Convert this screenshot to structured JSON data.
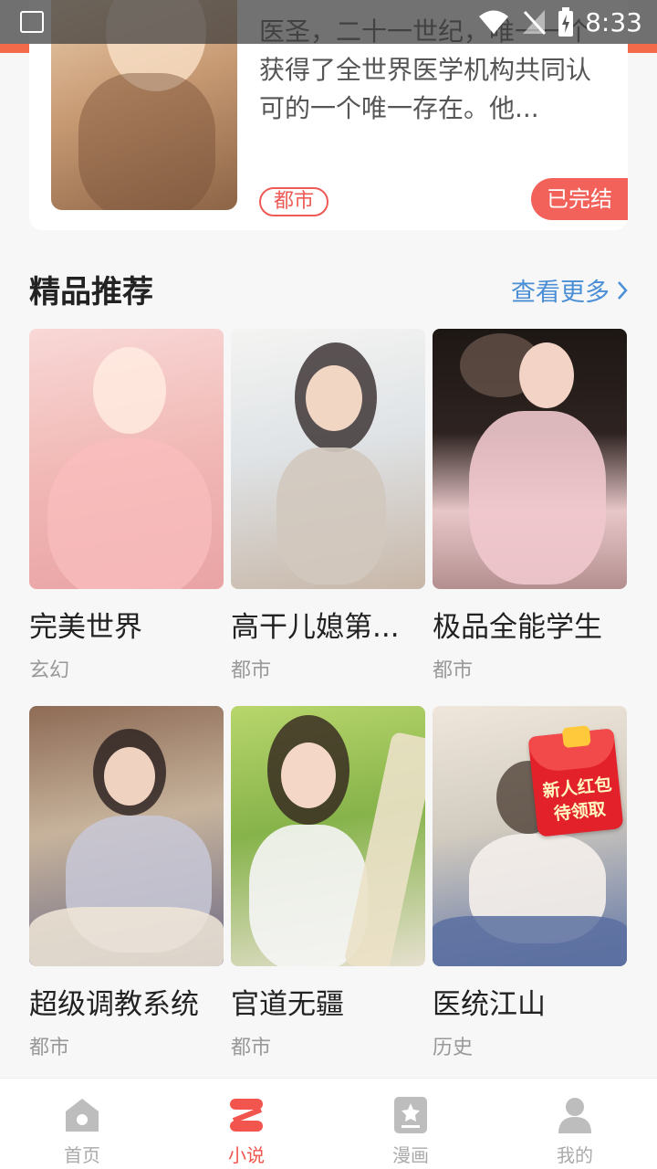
{
  "status_bar": {
    "time": "8:33"
  },
  "top_book": {
    "description": "医圣，二十一世纪，唯一一个获得了全世界医学机构共同认可的一个唯一存在。他...",
    "tag": "都市",
    "status": "已完结"
  },
  "section": {
    "title": "精品推荐",
    "more_label": "查看更多"
  },
  "books": [
    {
      "title": "完美世界",
      "genre": "玄幻"
    },
    {
      "title": "高干儿媳第...",
      "genre": "都市"
    },
    {
      "title": "极品全能学生",
      "genre": "都市"
    },
    {
      "title": "超级调教系统",
      "genre": "都市"
    },
    {
      "title": "官道无疆",
      "genre": "都市"
    },
    {
      "title": "医统江山",
      "genre": "历史"
    }
  ],
  "red_envelope": {
    "line1": "新人红包",
    "line2": "待领取"
  },
  "bottom_nav": [
    {
      "label": "首页",
      "icon": "home-icon",
      "active": false
    },
    {
      "label": "小说",
      "icon": "novel-icon",
      "active": true
    },
    {
      "label": "漫画",
      "icon": "comic-icon",
      "active": false
    },
    {
      "label": "我的",
      "icon": "profile-icon",
      "active": false
    }
  ],
  "colors": {
    "accent": "#f2544e",
    "link": "#4a8fd6",
    "tag": "#ee5a55"
  }
}
